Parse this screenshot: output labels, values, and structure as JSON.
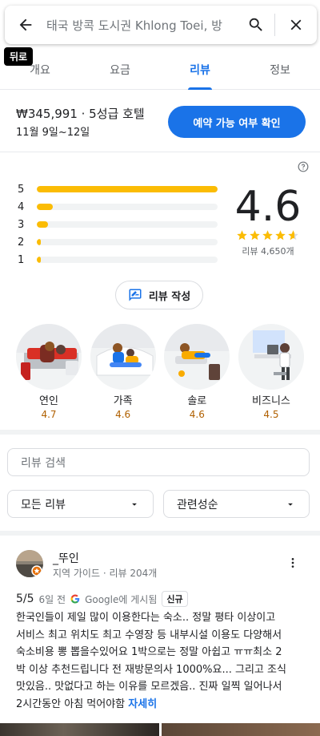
{
  "search": {
    "query": "태국 방콕 도시권 Khlong Toei, 방",
    "back_tooltip": "뒤로"
  },
  "tabs": [
    {
      "label": "개요"
    },
    {
      "label": "요금"
    },
    {
      "label": "리뷰",
      "active": true
    },
    {
      "label": "정보"
    }
  ],
  "offer": {
    "price_line": "₩345,991 · 5성급 호텔",
    "dates": "11월 9일~12일",
    "book_label": "예약 가능 여부 확인"
  },
  "rating": {
    "score": "4.6",
    "stars": 4.6,
    "count_text": "리뷰 4,650개",
    "distribution": [
      {
        "star": "5",
        "fraction": 1.0
      },
      {
        "star": "4",
        "fraction": 0.09
      },
      {
        "star": "3",
        "fraction": 0.06
      },
      {
        "star": "2",
        "fraction": 0.015
      },
      {
        "star": "1",
        "fraction": 0.02
      }
    ],
    "write_label": "리뷰 작성"
  },
  "categories": [
    {
      "label": "연인",
      "score": "4.7"
    },
    {
      "label": "가족",
      "score": "4.6"
    },
    {
      "label": "솔로",
      "score": "4.6"
    },
    {
      "label": "비즈니스",
      "score": "4.5"
    }
  ],
  "review_search": {
    "placeholder": "리뷰 검색"
  },
  "filters": {
    "all": "모든 리뷰",
    "sort": "관련성순"
  },
  "review": {
    "author": "_뚜인",
    "author_meta": "지역 가이드 · 리뷰 204개",
    "score": "5/5",
    "posted": "6일 전",
    "source_prefix": "Google",
    "source_suffix": "에 게시됨",
    "badge": "신규",
    "lines": [
      "한국인들이 제일 많이 이용한다는 숙소.. 정말 평타 이상이고",
      "서비스 최고 위치도 최고 수영장 등 내부시설 이용도 다양해서",
      "숙소비용 뽕 뽑을수있어요 1박으로는 정말 아쉽고 ㅠㅠ최소 2",
      "박 이상 추천드립니다 전 재방문의사 1000%요... 그리고 조식",
      "맛있음.. 맛없다고 하는 이유를 모르겠음.. 진짜 일찍 일어나서",
      "2시간동안 아침 먹어야함"
    ],
    "more_label": "자세히"
  },
  "colors": {
    "accent": "#1a73e8",
    "star": "#fbbc04",
    "score_brown": "#b06000"
  }
}
